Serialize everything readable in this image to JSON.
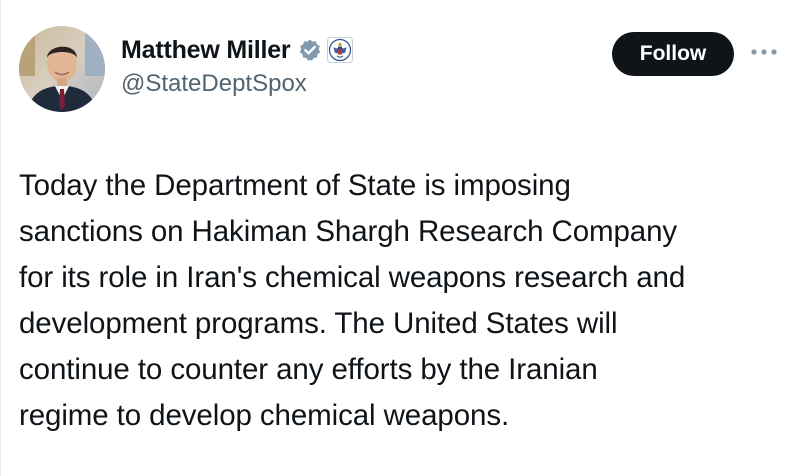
{
  "author": {
    "display_name": "Matthew Miller",
    "handle": "@StateDeptSpox",
    "verified_icon": "verified-badge-icon",
    "affiliation_icon": "state-department-seal-icon"
  },
  "actions": {
    "follow_label": "Follow",
    "more_icon": "more-options-icon"
  },
  "tweet": {
    "text": "Today the Department of State is imposing\nsanctions on Hakiman Shargh Research Company\nfor its role in Iran's chemical weapons research and\ndevelopment programs. The United States will\ncontinue to counter any efforts by the Iranian\nregime to develop chemical weapons."
  },
  "colors": {
    "text": "#0f1419",
    "secondary": "#536471",
    "verified_badge": "#829aab",
    "follow_bg": "#0f1419"
  }
}
